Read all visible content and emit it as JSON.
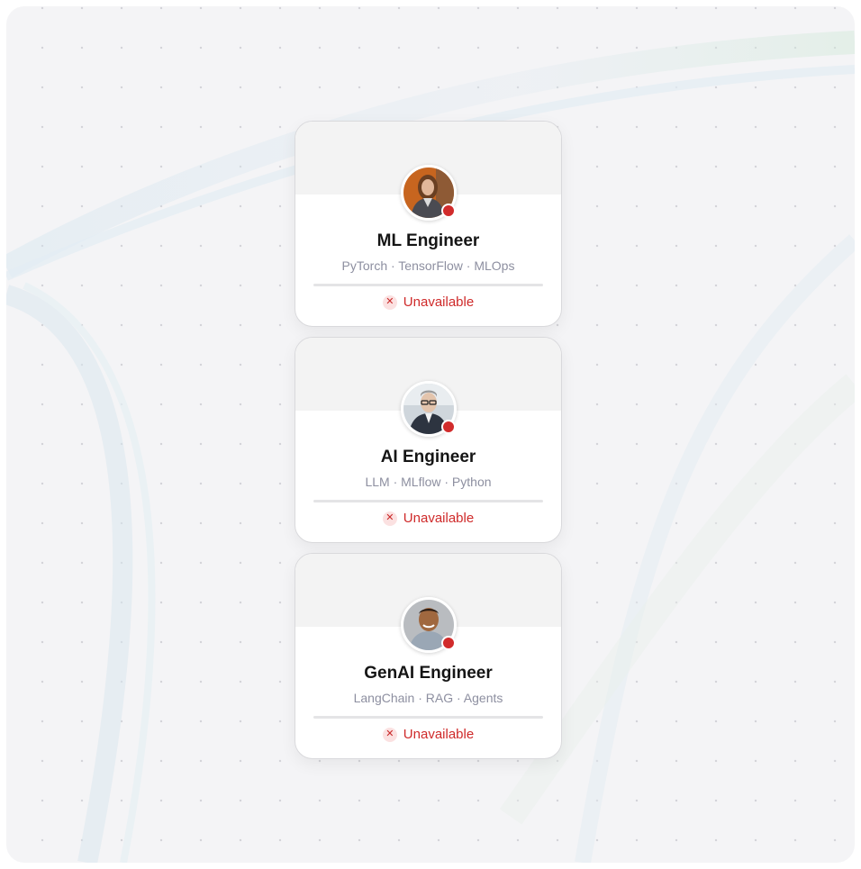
{
  "colors": {
    "status_unavailable": "#cf2a2a",
    "status_dot": "#d12b2b",
    "title_text": "#151515",
    "skills_text": "#8d8fa0",
    "banner": "#f3f3f3"
  },
  "cards": [
    {
      "title": "ML Engineer",
      "skills": "PyTorch · TensorFlow · MLOps",
      "status": "Unavailable",
      "status_icon": "close-icon",
      "avatar": "woman-portrait-orange-background"
    },
    {
      "title": "AI Engineer",
      "skills": "LLM · MLflow · Python",
      "status": "Unavailable",
      "status_icon": "close-icon",
      "avatar": "man-portrait-glasses-suit"
    },
    {
      "title": "GenAI Engineer",
      "skills": "LangChain · RAG · Agents",
      "status": "Unavailable",
      "status_icon": "close-icon",
      "avatar": "man-portrait-smiling"
    }
  ]
}
